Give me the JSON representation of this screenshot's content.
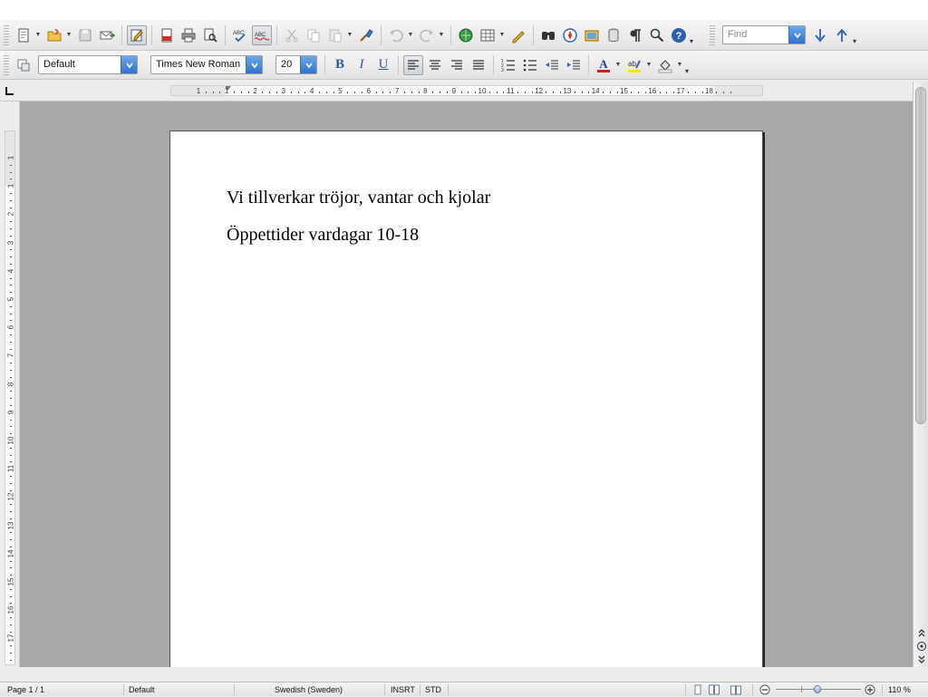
{
  "toolbar_standard": {
    "buttons": [
      {
        "name": "new-document-icon",
        "dropdown": true
      },
      {
        "name": "open-folder-icon",
        "dropdown": true
      },
      {
        "name": "save-icon"
      },
      {
        "name": "email-document-icon"
      },
      {
        "name": "edit-file-icon",
        "active": true
      },
      {
        "name": "export-pdf-icon"
      },
      {
        "name": "print-icon"
      },
      {
        "name": "print-preview-icon"
      },
      {
        "name": "spellcheck-icon"
      },
      {
        "name": "autospellcheck-icon",
        "active": true
      },
      {
        "name": "cut-icon"
      },
      {
        "name": "copy-icon"
      },
      {
        "name": "paste-icon",
        "dropdown": true
      },
      {
        "name": "clone-formatting-icon"
      },
      {
        "name": "undo-icon",
        "dropdown": true
      },
      {
        "name": "redo-icon",
        "dropdown": true
      },
      {
        "name": "hyperlink-icon"
      },
      {
        "name": "table-icon",
        "dropdown": true
      },
      {
        "name": "draw-functions-icon"
      },
      {
        "name": "find-replace-icon"
      },
      {
        "name": "navigator-icon"
      },
      {
        "name": "gallery-icon"
      },
      {
        "name": "data-sources-icon"
      },
      {
        "name": "formatting-marks-icon"
      },
      {
        "name": "zoom-icon"
      },
      {
        "name": "help-icon"
      }
    ],
    "find_placeholder": "Find",
    "find_next_icon": "arrow-down-icon",
    "find_prev_icon": "arrow-up-icon"
  },
  "toolbar_formatting": {
    "styles_icon": "styles-formatting-icon",
    "paragraph_style": "Default",
    "font_name": "Times New Roman",
    "font_size": "20",
    "bold_label": "B",
    "italic_label": "I",
    "underline_label": "U",
    "text_color_label": "A",
    "highlight_label": "ab"
  },
  "rulers": {
    "horizontal_numbers": [
      "1",
      "1",
      "2",
      "3",
      "4",
      "5",
      "6",
      "7",
      "8",
      "9",
      "10",
      "11",
      "12",
      "13",
      "14",
      "15",
      "16",
      "17",
      "18"
    ],
    "vertical_numbers": [
      "1",
      "1",
      "2",
      "3",
      "4",
      "5",
      "6",
      "7",
      "8",
      "9",
      "10",
      "11",
      "12",
      "13",
      "14",
      "15",
      "16",
      "17"
    ]
  },
  "document": {
    "lines": [
      "Vi tillverkar tröjor, vantar och kjolar",
      "Öppettider vardagar 10-18"
    ]
  },
  "statusbar": {
    "page": "Page 1 / 1",
    "page_style": "Default",
    "language": "Swedish (Sweden)",
    "insert_mode": "INSRT",
    "selection_mode": "STD",
    "zoom": "110 %"
  },
  "colors": {
    "accent": "#2e72cc",
    "workspace_bg": "#a8a8a8",
    "font_color_underline": "#d21c1c",
    "highlight_underline": "#ffe400"
  }
}
